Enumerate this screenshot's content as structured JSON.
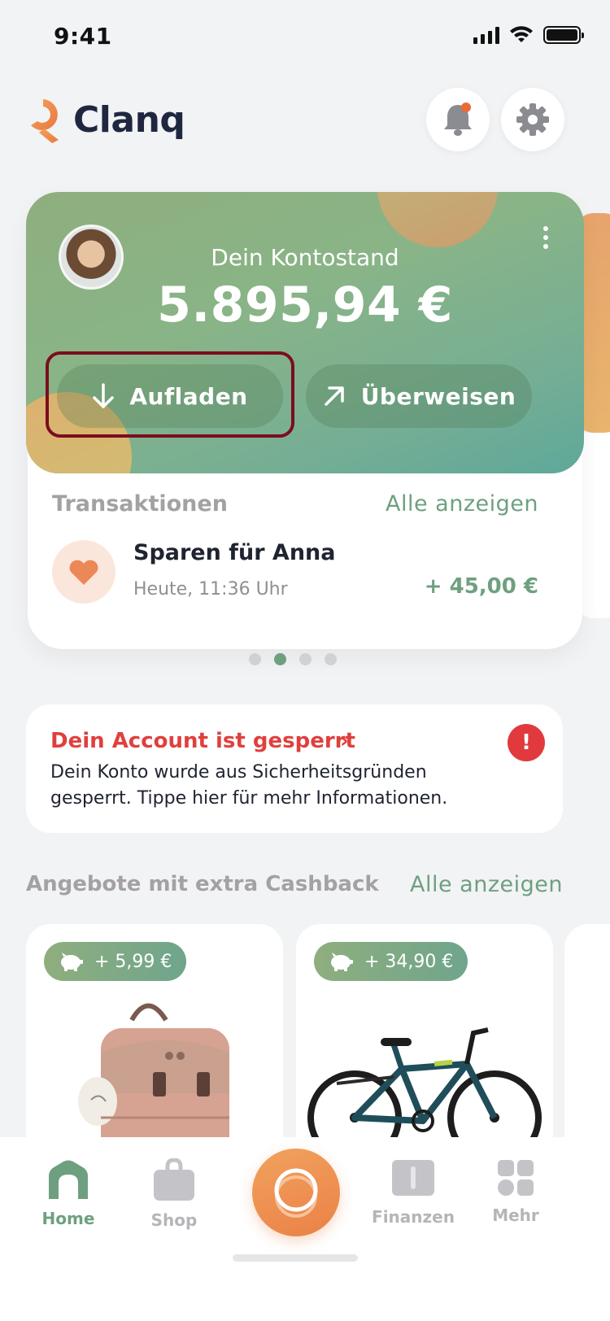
{
  "status_bar": {
    "time": "9:41"
  },
  "app": {
    "name": "Clanq"
  },
  "balance": {
    "label": "Dein Kontostand",
    "amount": "5.895,94 €",
    "topup_label": "Aufladen",
    "transfer_label": "Überweisen"
  },
  "transactions": {
    "title": "Transaktionen",
    "show_all": "Alle anzeigen",
    "items": [
      {
        "name": "Sparen für Anna",
        "date": "Heute, 11:36 Uhr",
        "amount": "+ 45,00 €"
      }
    ]
  },
  "carousel": {
    "pages": 4,
    "active_index": 1
  },
  "alert": {
    "title": "Dein Account ist gesperrt",
    "chevron": "›",
    "text": "Dein Konto wurde aus Sicherheitsgründen gesperrt. Tippe hier für mehr Informationen.",
    "badge": "!"
  },
  "offers": {
    "title": "Angebote mit extra Cashback",
    "show_all": "Alle anzeigen",
    "items": [
      {
        "cashback": "+ 5,99 €",
        "icon": "piggy-bank-icon",
        "product": "backpack"
      },
      {
        "cashback": "+ 34,90 €",
        "icon": "piggy-bank-icon",
        "product": "bicycle"
      }
    ]
  },
  "tabs": [
    {
      "label": "Home",
      "icon": "home-icon",
      "active": true
    },
    {
      "label": "Shop",
      "icon": "shopping-bag-icon",
      "active": false
    },
    {
      "label": "",
      "icon": "coin-icon",
      "active": false
    },
    {
      "label": "Finanzen",
      "icon": "book-icon",
      "active": false
    },
    {
      "label": "Mehr",
      "icon": "grid-icon",
      "active": false
    }
  ],
  "colors": {
    "accent_green": "#6ea07f",
    "accent_orange": "#ea8146",
    "alert_red": "#e0403d",
    "highlight": "#7b0d1e"
  }
}
